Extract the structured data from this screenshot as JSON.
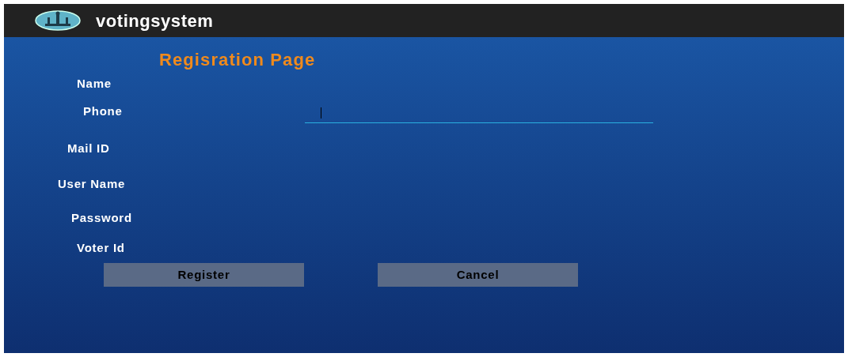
{
  "app_bar": {
    "title": "votingsystem"
  },
  "heading": "Regisration Page",
  "fields": [
    {
      "label": "Name",
      "focused": false
    },
    {
      "label": "Phone",
      "focused": true
    },
    {
      "label": "Mail ID",
      "focused": false
    },
    {
      "label": "User Name",
      "focused": false
    },
    {
      "label": "Password",
      "focused": false
    },
    {
      "label": "Voter Id",
      "focused": false
    }
  ],
  "buttons": [
    "Register",
    "Cancel"
  ]
}
